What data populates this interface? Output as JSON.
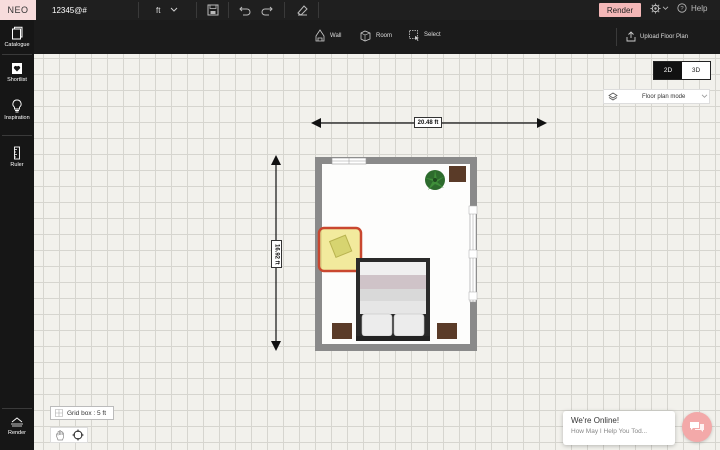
{
  "app": {
    "logo": "NEO",
    "project_name": "12345@#"
  },
  "topbar": {
    "unit": "ft",
    "render_label": "Render",
    "help_label": "Help"
  },
  "toolbar": {
    "wall_label": "Wall",
    "room_label": "Room",
    "select_label": "Select",
    "upload_label": "Upload Floor Plan"
  },
  "sidebar": {
    "items": [
      {
        "label": "Catalogue",
        "icon": "catalogue-icon"
      },
      {
        "label": "Shortlist",
        "icon": "heart-icon"
      },
      {
        "label": "Inspiration",
        "icon": "lightbulb-icon"
      },
      {
        "label": "Ruler",
        "icon": "ruler-icon"
      }
    ],
    "render_label": "Render"
  },
  "view": {
    "active": "2D",
    "inactive": "3D"
  },
  "mode": {
    "selected": "Floor plan mode"
  },
  "dimensions": {
    "width": "20.48 ft",
    "height": "16.92 ft"
  },
  "grid": {
    "label": "Grid box : 5 ft"
  },
  "chat": {
    "title": "We're Online!",
    "subtitle": "How May I Help You Tod..."
  },
  "colors": {
    "accent": "#f4b7b7",
    "selection": "#c9472f",
    "highlight": "#f0e68c"
  }
}
